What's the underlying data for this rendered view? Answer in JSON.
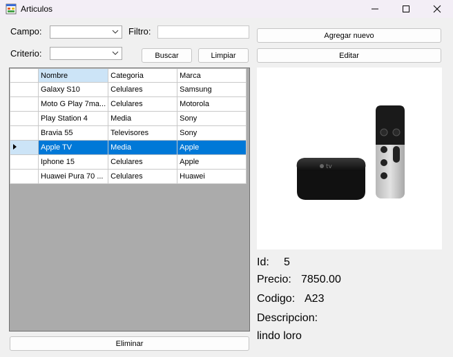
{
  "window": {
    "title": "Articulos"
  },
  "filters": {
    "campo_label": "Campo:",
    "filtro_label": "Filtro:",
    "criterio_label": "Criterio:",
    "buscar": "Buscar",
    "limpiar": "Limpiar"
  },
  "actions": {
    "agregar": "Agregar nuevo",
    "editar": "Editar",
    "eliminar": "Eliminar"
  },
  "table": {
    "columns": [
      "Nombre",
      "Categoria",
      "Marca"
    ],
    "rows": [
      {
        "nombre": "Galaxy S10",
        "categoria": "Celulares",
        "marca": "Samsung"
      },
      {
        "nombre": "Moto G Play 7ma...",
        "categoria": "Celulares",
        "marca": "Motorola"
      },
      {
        "nombre": "Play Station 4",
        "categoria": "Media",
        "marca": "Sony"
      },
      {
        "nombre": "Bravia 55",
        "categoria": "Televisores",
        "marca": "Sony"
      },
      {
        "nombre": "Apple TV",
        "categoria": "Media",
        "marca": "Apple"
      },
      {
        "nombre": "Iphone 15",
        "categoria": "Celulares",
        "marca": "Apple"
      },
      {
        "nombre": "Huawei Pura 70 ...",
        "categoria": "Celulares",
        "marca": "Huawei"
      }
    ],
    "selected_index": 4
  },
  "details": {
    "id_label": "Id:",
    "id": "5",
    "precio_label": "Precio:",
    "precio": "7850.00",
    "codigo_label": "Codigo:",
    "codigo": "A23",
    "descripcion_label": "Descripcion:",
    "descripcion": "lindo loro"
  },
  "colors": {
    "selection": "#0078d7",
    "header_selected": "#cce4f7",
    "grid_bg": "#ababab"
  }
}
